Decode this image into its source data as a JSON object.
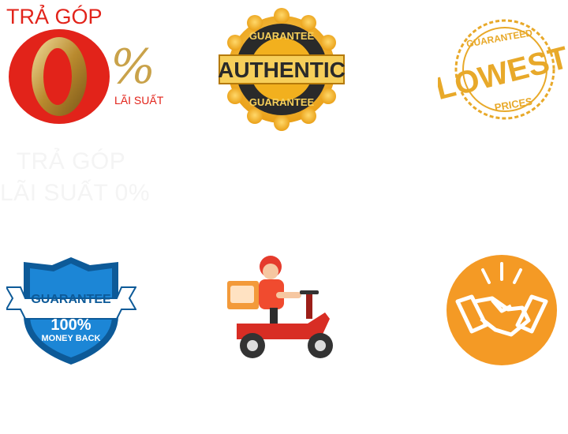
{
  "badges": [
    {
      "name": "installment-zero-interest",
      "top_text": "TRẢ GÓP",
      "big_digit": "0",
      "percent": "%",
      "sub_text": "LÃI SUẤT",
      "caption_line1": "TRẢ GÓP",
      "caption_line2": "LÃI SUẤT 0%",
      "colors": {
        "red": "#e2231a",
        "gold": "#c9a24a"
      }
    },
    {
      "name": "authentic-guarantee",
      "top_arc": "GUARANTEE",
      "main": "AUTHENTIC",
      "bottom_arc": "GUARANTEE",
      "colors": {
        "gold": "#f2b01e",
        "dark": "#2a2a2a",
        "banner": "#f7cf5a"
      }
    },
    {
      "name": "lowest-prices",
      "top_arc": "GUARANTEED",
      "main": "LOWEST",
      "bottom_arc": "PRICES",
      "colors": {
        "gold": "#e8a92a"
      }
    },
    {
      "name": "money-back-guarantee",
      "ribbon": "GUARANTEE",
      "big": "100%",
      "sub": "MONEY BACK",
      "colors": {
        "blue": "#1c86d6",
        "dark": "#0d5a98",
        "ribbon": "#ffffff"
      }
    },
    {
      "name": "delivery-scooter",
      "colors": {
        "red": "#e53b2c",
        "orange": "#f39a3a"
      }
    },
    {
      "name": "handshake-deal",
      "colors": {
        "orange": "#f49a25",
        "white": "#ffffff"
      }
    }
  ]
}
